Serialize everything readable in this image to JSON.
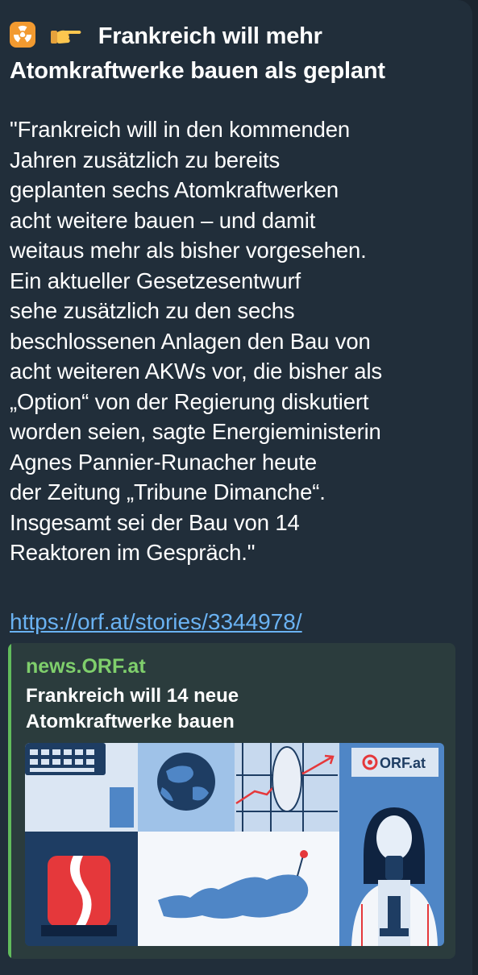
{
  "message": {
    "title_emoji_1": "radioactive-icon",
    "title_emoji_2": "pointing-hand-icon",
    "title_line_1": "Frankreich will mehr",
    "title_line_2": "Atomkraftwerke bauen als geplant",
    "body_lines": [
      "\"Frankreich will in den kommenden",
      "Jahren zusätzlich zu bereits",
      "geplanten sechs Atomkraftwerken",
      "acht weitere bauen – und damit",
      "weitaus mehr als bisher vorgesehen.",
      "Ein aktueller Gesetzesentwurf",
      "sehe zusätzlich zu den sechs",
      "beschlossenen Anlagen den Bau von",
      "acht weiteren AKWs vor, die bisher als",
      "„Option“ von der Regierung diskutiert",
      "worden seien, sagte Energieministerin",
      "Agnes Pannier-Runacher heute",
      "der Zeitung „Tribune Dimanche“.",
      "Insgesamt sei der Bau von 14",
      "Reaktoren im Gespräch.\""
    ],
    "link": "https://orf.at/stories/3344978/"
  },
  "preview": {
    "site_name": "news.ORF.at",
    "title_line_1": "Frankreich will 14 neue",
    "title_line_2": "Atomkraftwerke bauen",
    "image_logo_text": "ORF.at"
  },
  "colors": {
    "background": "#1b252f",
    "bubble": "#212e3a",
    "link": "#6ab2f2",
    "preview_bar": "#61bc5c",
    "site_name": "#7fcf6c",
    "orf_red": "#e5383b",
    "illustration_blue": "#4f86c6"
  }
}
